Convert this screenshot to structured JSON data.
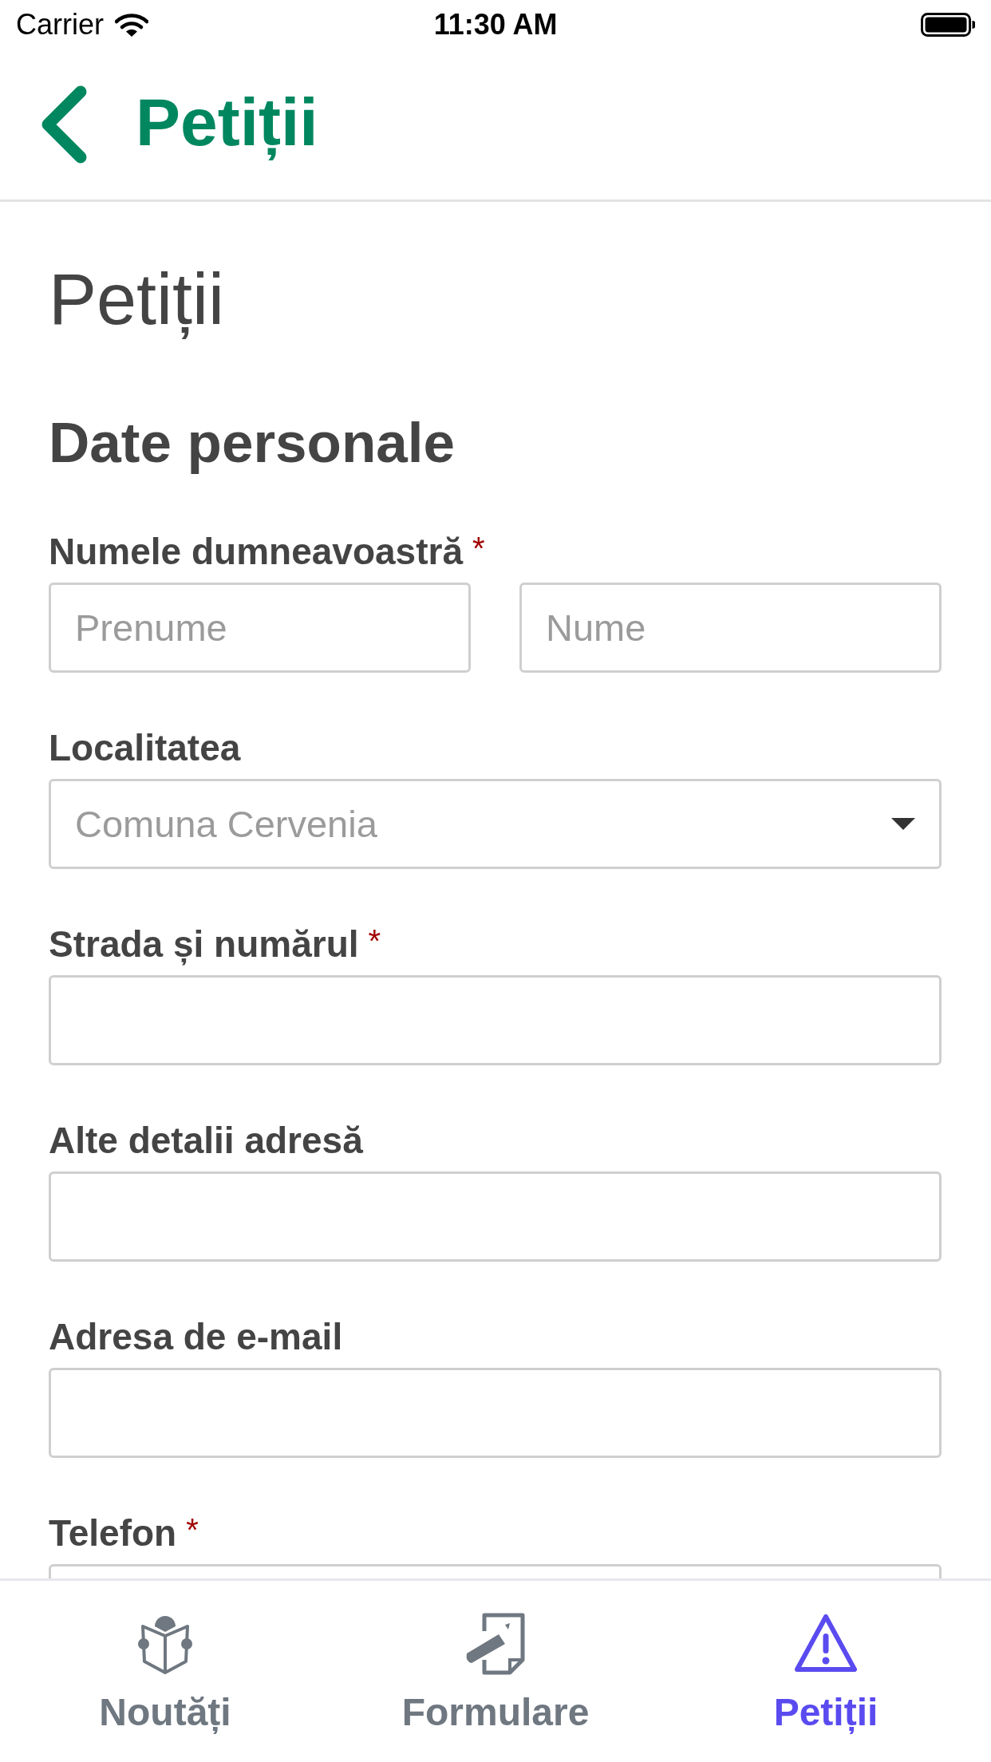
{
  "status_bar": {
    "carrier": "Carrier",
    "time": "11:30 AM"
  },
  "nav_bar": {
    "title": "Petiții"
  },
  "page": {
    "title": "Petiții",
    "section_title": "Date personale"
  },
  "fields": [
    {
      "kind": "name_pair",
      "label": "Numele dumneavoastră",
      "required_mark": "*",
      "inputs": [
        {
          "placeholder": "Prenume"
        },
        {
          "placeholder": "Nume"
        }
      ]
    },
    {
      "kind": "select",
      "label": "Localitatea",
      "value": "Comuna Cervenia"
    },
    {
      "kind": "text",
      "label": "Strada și numărul",
      "required_mark": "*"
    },
    {
      "kind": "text",
      "label": "Alte detalii adresă"
    },
    {
      "kind": "text",
      "label": "Adresa de e-mail"
    },
    {
      "kind": "text",
      "label": "Telefon",
      "required_mark": "*"
    }
  ],
  "tabs": [
    {
      "label": "Noutăți",
      "selected": false
    },
    {
      "label": "Formulare",
      "selected": false
    },
    {
      "label": "Petiții",
      "selected": true
    }
  ]
}
